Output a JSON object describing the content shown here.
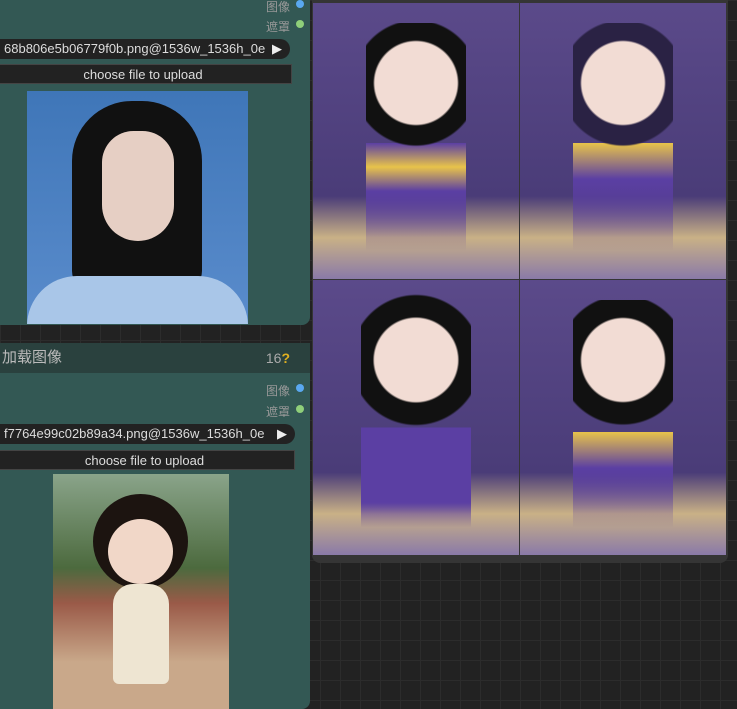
{
  "node1": {
    "outputs": [
      {
        "label": "图像",
        "color": "#5aa8f0"
      },
      {
        "label": "遮罩",
        "color": "#8fcf7a"
      }
    ],
    "filename": "68b806e5b06779f0b.png@1536w_1536h_0e",
    "upload_label": "choose file to upload"
  },
  "node2": {
    "title": "加载图像",
    "count": "16",
    "help": "?",
    "outputs": [
      {
        "label": "图像",
        "color": "#5aa8f0"
      },
      {
        "label": "遮罩",
        "color": "#8fcf7a"
      }
    ],
    "filename": "f7764e99c02b89a34.png@1536w_1536h_0e",
    "upload_label": "choose file to upload"
  },
  "preview": {
    "image_count": 4
  }
}
